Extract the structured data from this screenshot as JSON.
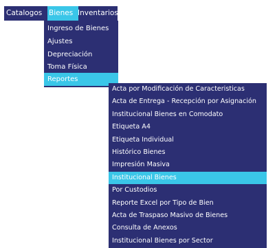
{
  "colors": {
    "menu_background": "#2c2f73",
    "highlight": "#3ac6e8",
    "text": "#ffffff"
  },
  "menubar": {
    "items": [
      {
        "label": "Catalogos"
      },
      {
        "label": "Bienes"
      },
      {
        "label": "Inventarios"
      }
    ],
    "selected": "Bienes"
  },
  "bienes_menu": {
    "items": [
      {
        "label": "Ingreso de Bienes"
      },
      {
        "label": "Ajustes"
      },
      {
        "label": "Depreciación"
      },
      {
        "label": "Toma Física"
      },
      {
        "label": "Reportes"
      }
    ],
    "selected": "Reportes"
  },
  "reportes_submenu": {
    "items": [
      {
        "label": "Acta por Modificación de Caracteristicas"
      },
      {
        "label": "Acta de Entrega - Recepción por Asignación"
      },
      {
        "label": "Institucional Bienes en Comodato"
      },
      {
        "label": "Etiqueta A4"
      },
      {
        "label": "Etiqueta Individual"
      },
      {
        "label": "Histórico Bienes"
      },
      {
        "label": "Impresión Masiva"
      },
      {
        "label": "Institucional Bienes"
      },
      {
        "label": "Por Custodios"
      },
      {
        "label": "Reporte Excel por Tipo de Bien"
      },
      {
        "label": "Acta de Traspaso Masivo de Bienes"
      },
      {
        "label": "Consulta de Anexos"
      },
      {
        "label": "Institucional Bienes por Sector"
      }
    ],
    "selected": "Institucional Bienes"
  }
}
